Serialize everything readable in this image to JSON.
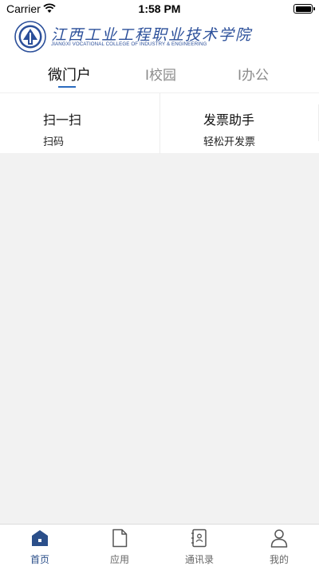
{
  "status_bar": {
    "carrier": "Carrier",
    "time": "1:58 PM"
  },
  "header": {
    "logo_cn": "江西工业工程职业技术学院",
    "logo_en": "JIANGXI VOCATIONAL COLLEGE OF INDUSTRY & ENGINEERING",
    "brand_color": "#2b4f9a"
  },
  "tabs": [
    {
      "label": "微门户",
      "active": true
    },
    {
      "label": "I校园",
      "active": false
    },
    {
      "label": "I办公",
      "active": false
    }
  ],
  "quick_items": [
    {
      "title": "扫一扫",
      "subtitle": "扫码"
    },
    {
      "title": "发票助手",
      "subtitle": "轻松开发票"
    }
  ],
  "tabbar": [
    {
      "label": "首页",
      "icon": "home-icon",
      "active": true
    },
    {
      "label": "应用",
      "icon": "document-icon",
      "active": false
    },
    {
      "label": "通讯录",
      "icon": "contacts-icon",
      "active": false
    },
    {
      "label": "我的",
      "icon": "user-icon",
      "active": false
    }
  ],
  "colors": {
    "accent": "#2b6bbf",
    "active_tab": "#2b4f8a",
    "background": "#f2f2f2"
  }
}
